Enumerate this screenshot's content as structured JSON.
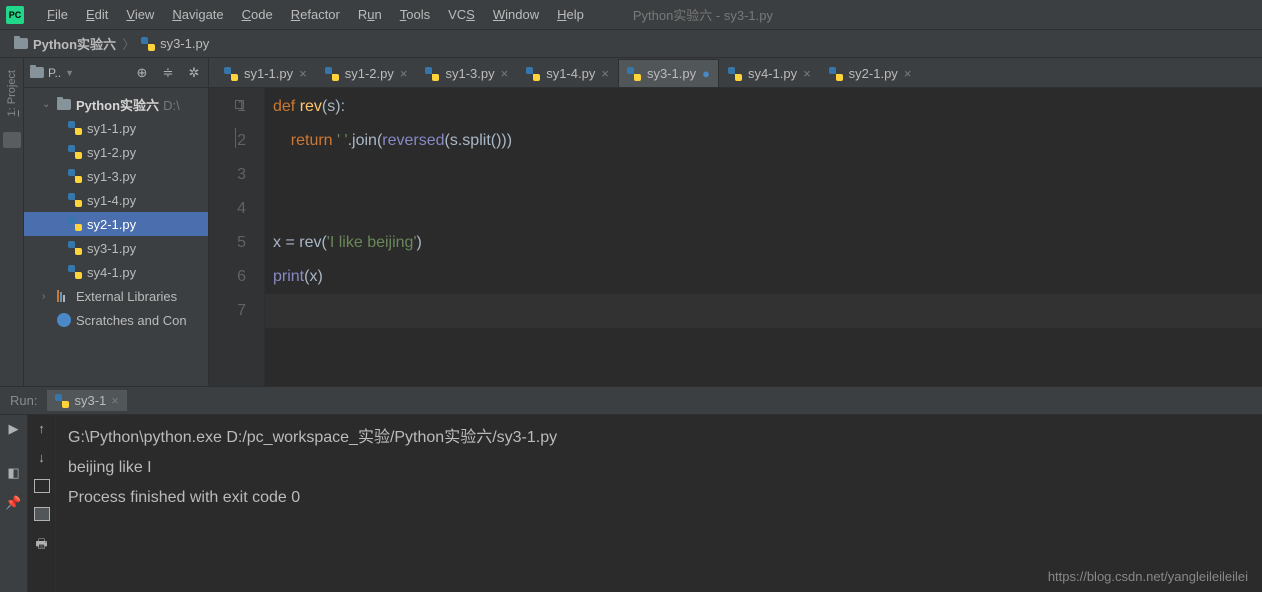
{
  "window": {
    "title": "Python实验六 - sy3-1.py"
  },
  "menu": [
    "File",
    "Edit",
    "View",
    "Navigate",
    "Code",
    "Refactor",
    "Run",
    "Tools",
    "VCS",
    "Window",
    "Help"
  ],
  "breadcrumb": {
    "root": "Python实验六",
    "file": "sy3-1.py"
  },
  "project_panel": {
    "title": "P..",
    "root": "Python实验六",
    "root_path": "D:\\",
    "files": [
      "sy1-1.py",
      "sy1-2.py",
      "sy1-3.py",
      "sy1-4.py",
      "sy2-1.py",
      "sy3-1.py",
      "sy4-1.py"
    ],
    "selected": "sy2-1.py",
    "ext_lib": "External Libraries",
    "scratches": "Scratches and Con"
  },
  "side_tab": {
    "project": "1: Project"
  },
  "editor_tabs": [
    {
      "name": "sy1-1.py",
      "active": false,
      "modified": false
    },
    {
      "name": "sy1-2.py",
      "active": false,
      "modified": false
    },
    {
      "name": "sy1-3.py",
      "active": false,
      "modified": false
    },
    {
      "name": "sy1-4.py",
      "active": false,
      "modified": false
    },
    {
      "name": "sy3-1.py",
      "active": true,
      "modified": true
    },
    {
      "name": "sy4-1.py",
      "active": false,
      "modified": false
    },
    {
      "name": "sy2-1.py",
      "active": false,
      "modified": false
    }
  ],
  "code": {
    "lines": [
      "1",
      "2",
      "3",
      "4",
      "5",
      "6",
      "7"
    ],
    "l1": {
      "def": "def ",
      "fn": "rev",
      "rest": "(s):"
    },
    "l2": {
      "ret": "return ",
      "s1": "' '",
      "join": ".join(",
      "rev": "reversed",
      "mid": "(s.split()))"
    },
    "l5": {
      "pre": "x = rev(",
      "s": "'I like beijing'",
      "post": ")"
    },
    "l6": {
      "pr": "print",
      "post": "(x)"
    }
  },
  "run": {
    "title": "Run:",
    "tab": "sy3-1",
    "lines": [
      "G:\\Python\\python.exe D:/pc_workspace_实验/Python实验六/sy3-1.py",
      "beijing like I",
      "",
      "Process finished with exit code 0"
    ]
  },
  "watermark": "https://blog.csdn.net/yangleileileilei"
}
